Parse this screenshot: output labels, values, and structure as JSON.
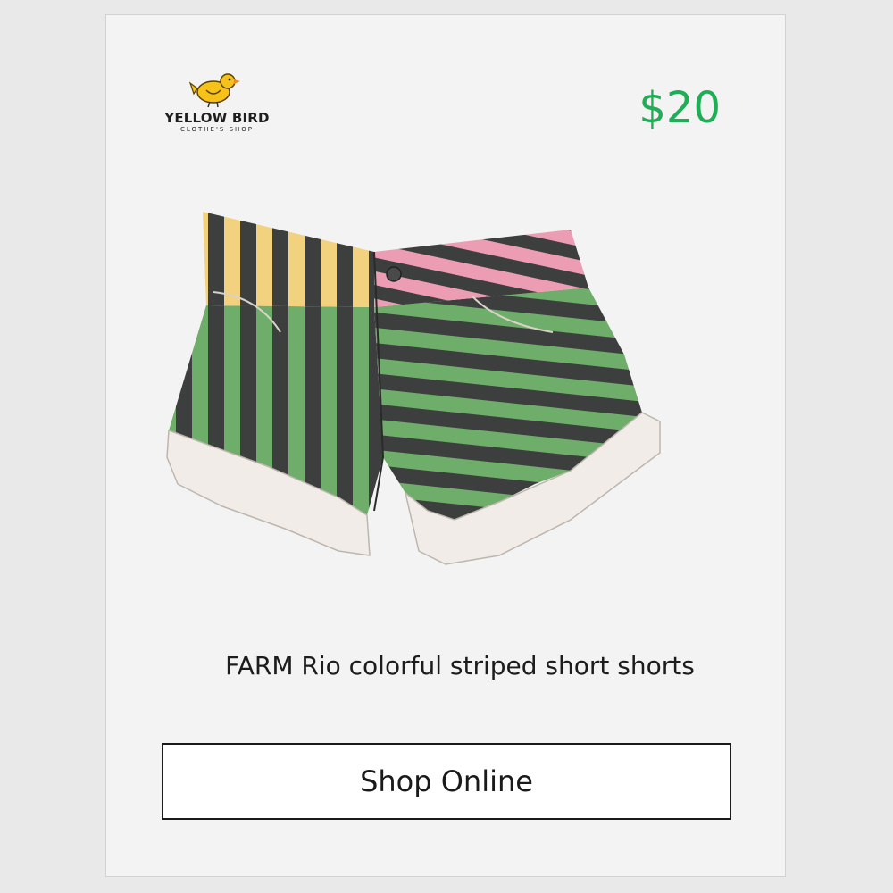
{
  "brand": {
    "name": "YELLOW BIRD",
    "tagline": "CLOTHE'S SHOP",
    "logo_icon": "yellow-bird-icon"
  },
  "product": {
    "price": "$20",
    "title": "FARM Rio colorful striped short shorts",
    "image_icon": "striped-shorts-photo"
  },
  "actions": {
    "shop_label": "Shop Online"
  },
  "colors": {
    "price": "#1fad56",
    "stripe_green": "#6fae6a",
    "stripe_dark": "#3d3f3e",
    "stripe_yellow": "#f2d27e",
    "stripe_pink": "#ec9db3",
    "cuff_white": "#f1ece8"
  }
}
